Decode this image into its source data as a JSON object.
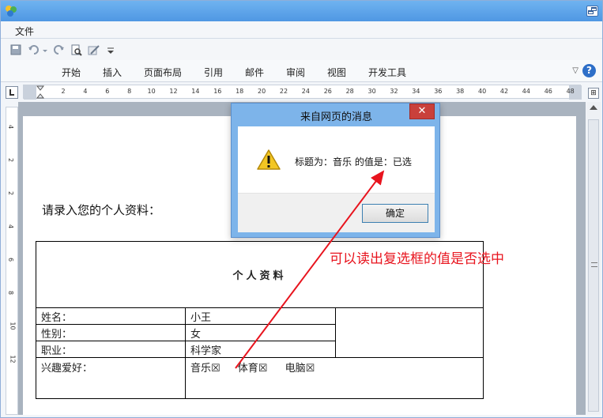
{
  "menu": {
    "file": "文件"
  },
  "ribbon": {
    "tabs": [
      {
        "label": "开始"
      },
      {
        "label": "插入"
      },
      {
        "label": "页面布局"
      },
      {
        "label": "引用"
      },
      {
        "label": "邮件"
      },
      {
        "label": "审阅"
      },
      {
        "label": "视图"
      },
      {
        "label": "开发工具"
      }
    ],
    "help": "?"
  },
  "ruler": {
    "h_numbers": [
      "2",
      "4",
      "6",
      "8",
      "10",
      "12",
      "14",
      "16",
      "18",
      "20",
      "22",
      "24",
      "26",
      "28",
      "30",
      "32",
      "34",
      "36",
      "38",
      "40",
      "42",
      "44",
      "46",
      "48"
    ],
    "v_numbers": [
      "4",
      "2",
      "2",
      "4",
      "6",
      "8",
      "10",
      "12"
    ]
  },
  "document": {
    "prompt": "请录入您的个人资料：",
    "table": {
      "title": "个人资料",
      "rows": [
        {
          "label": "姓名：",
          "value": "小王"
        },
        {
          "label": "性别：",
          "value": "女"
        },
        {
          "label": "职业：",
          "value": "科学家"
        }
      ],
      "hobby_label": "兴趣爱好：",
      "hobbies": [
        {
          "label": "音乐☒"
        },
        {
          "label": "体育☒"
        },
        {
          "label": "电脑☒"
        }
      ]
    }
  },
  "dialog": {
    "title": "来自网页的消息",
    "close": "✕",
    "message": "标题为：音乐 的值是：已选",
    "ok_label": "确定"
  },
  "annotation": {
    "text": "可以读出复选框的值是否选中",
    "color": "#e8141e"
  }
}
